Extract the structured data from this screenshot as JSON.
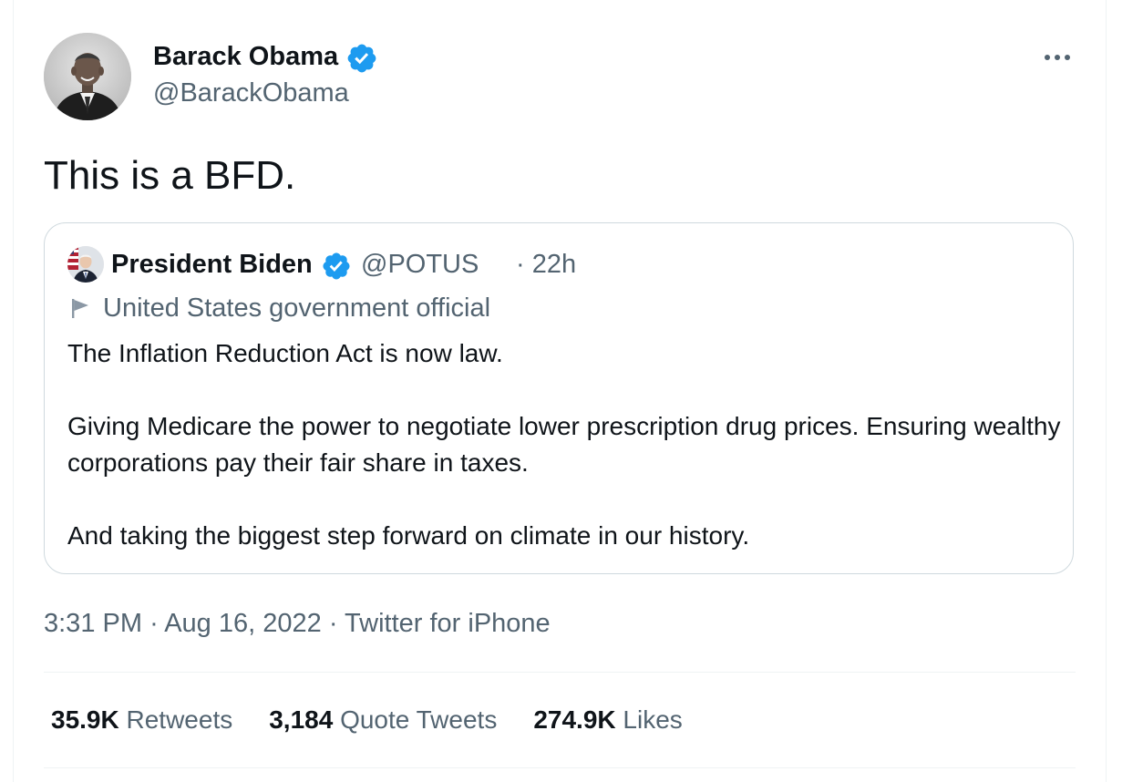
{
  "author": {
    "display_name": "Barack Obama",
    "handle": "@BarackObama",
    "verified": true
  },
  "tweet": {
    "text": "This is a BFD."
  },
  "quoted_tweet": {
    "display_name": "President Biden",
    "handle": "@POTUS",
    "time": "· 22h",
    "label": "United States government official",
    "paragraphs": [
      "The Inflation Reduction Act is now law.",
      "Giving Medicare the power to negotiate lower prescription drug prices. Ensuring wealthy corporations pay their fair share in taxes.",
      "And taking the biggest step forward on climate in our history."
    ]
  },
  "meta": {
    "time": "3:31 PM",
    "separator": "·",
    "date": "Aug 16, 2022",
    "source": "Twitter for iPhone"
  },
  "stats": {
    "retweets": {
      "count": "35.9K",
      "label": "Retweets"
    },
    "quotes": {
      "count": "3,184",
      "label": "Quote Tweets"
    },
    "likes": {
      "count": "274.9K",
      "label": "Likes"
    }
  },
  "colors": {
    "verified": "#1d9bf0",
    "secondary_text": "#536471",
    "primary_text": "#0f1419",
    "border": "#cfd9de"
  },
  "icons": [
    "verified-badge-icon",
    "more-options-icon",
    "government-flag-icon"
  ]
}
